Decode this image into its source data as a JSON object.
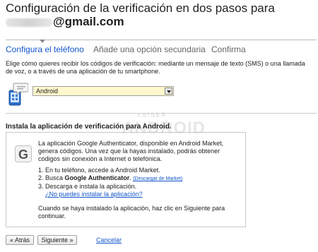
{
  "header": {
    "title_line1": "Configuración de la verificación en dos pasos para",
    "email_domain": "@gmail.com"
  },
  "steps": [
    {
      "label": "Configura el teléfono"
    },
    {
      "label": "Añade una opción secundaria"
    },
    {
      "label": "Confirma"
    }
  ],
  "intro": {
    "text": "Elige cómo quieres recibir los códigos de verificación: mediante un mensaje de texto (SMS) o una llamada de voz, o a través de una aplicación de tu smartphone."
  },
  "device_select": {
    "selected": "Android"
  },
  "watermark": {
    "small": "xatakA",
    "big": "ANDROID"
  },
  "section": {
    "title": "Instala la aplicación de verificación para Android."
  },
  "instructions": {
    "paragraph": "La aplicación Google Authenticator, disponible en Android Market, genera códigos. Una vez que la hayas instalado, podrás obtener códigos sin conexión a Internet o telefónica.",
    "step1": "1. En tu teléfono, accede a Android Market.",
    "step2_prefix": "2. Busca ",
    "step2_bold": "Google Authenticator",
    "step2_suffix": ". ",
    "step2_link": "(Descargar de Market)",
    "step3": "3. Descarga e instala la aplicación.",
    "help_link": "¿No puedes instalar la aplicación?",
    "final": "Cuando se haya instalado la aplicación, haz clic en Siguiente para continuar."
  },
  "buttons": {
    "back": "« Atrás",
    "next": "Siguiente »",
    "cancel": "Cancelar"
  },
  "colors": {
    "link": "#1155cc",
    "select_bg": "#fff8cc"
  }
}
